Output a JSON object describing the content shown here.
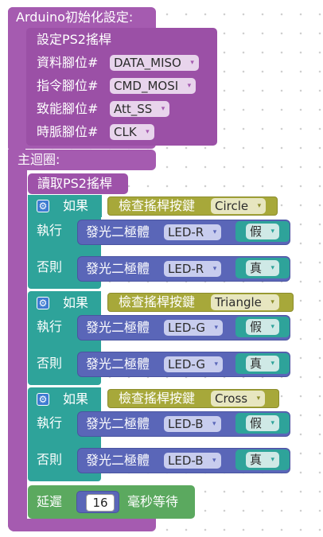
{
  "setup": {
    "header": "Arduino初始化設定:",
    "ps2_block": {
      "title": "設定PS2搖桿",
      "rows": [
        {
          "label": "資料腳位#",
          "value": "DATA_MISO"
        },
        {
          "label": "指令腳位#",
          "value": "CMD_MOSI"
        },
        {
          "label": "致能腳位#",
          "value": "Att_SS"
        },
        {
          "label": "時脈腳位#",
          "value": "CLK"
        }
      ]
    }
  },
  "loop": {
    "header": "主迴圈:",
    "read_ps2": "讀取PS2搖桿",
    "if_label": "如果",
    "do_label": "執行",
    "else_label": "否則",
    "check_label": "檢查搖桿按鍵",
    "led_label": "發光二極體",
    "if_blocks": [
      {
        "button": "Circle",
        "led": "LED-R",
        "do_value": "假",
        "else_value": "真"
      },
      {
        "button": "Triangle",
        "led": "LED-G",
        "do_value": "假",
        "else_value": "真"
      },
      {
        "button": "Cross",
        "led": "LED-B",
        "do_value": "假",
        "else_value": "真"
      }
    ],
    "delay": {
      "label": "延遲",
      "value": "16",
      "unit": "毫秒等待"
    }
  },
  "icons": {
    "dropdown": "▾",
    "gear": "⚙"
  },
  "colors": {
    "purple": "#a55bb0",
    "teal": "#2ea39a",
    "olive": "#a7a83a",
    "indigo": "#5a66b8",
    "green": "#5ba95f"
  }
}
